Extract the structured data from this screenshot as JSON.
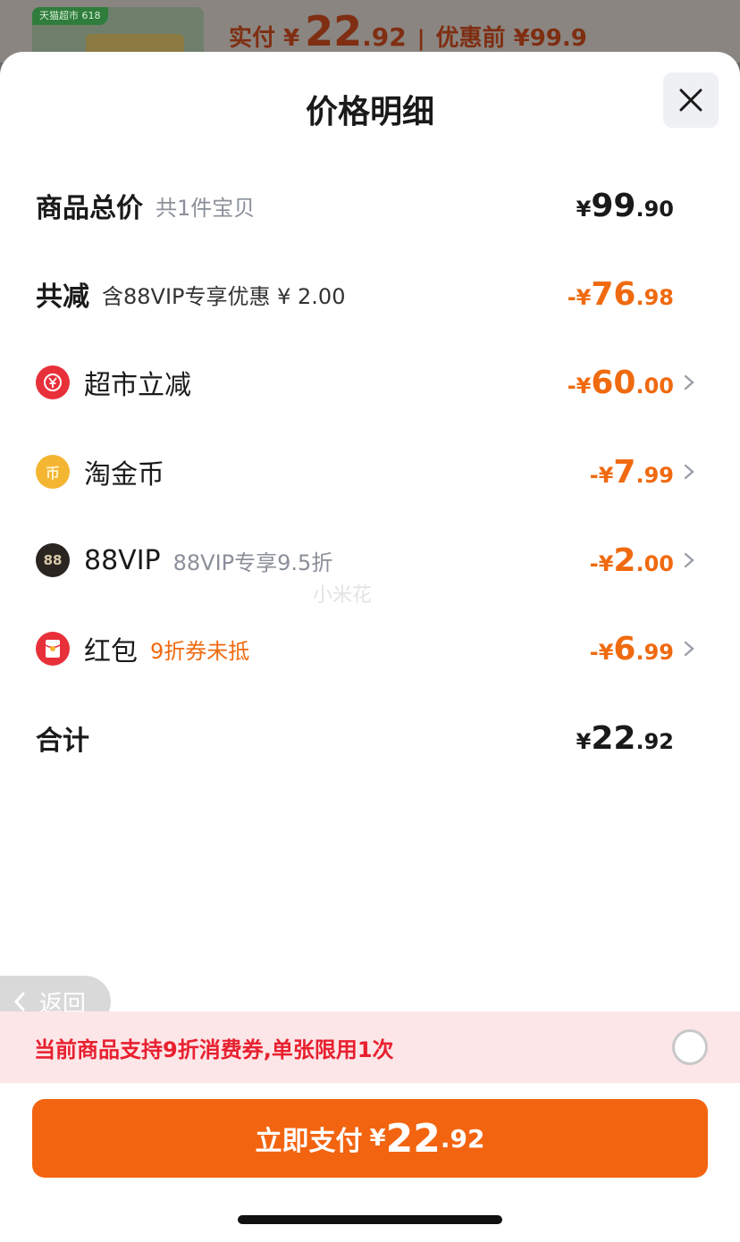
{
  "top": {
    "badge": "天猫超市 618",
    "pay_label": "实付 ¥",
    "pay_int": "22",
    "pay_dec": ".92",
    "sep": "|",
    "orig": "优惠前 ¥99.9"
  },
  "sheet": {
    "title": "价格明细"
  },
  "rows": {
    "total": {
      "name": "商品总价",
      "sub": "共1件宝贝",
      "cur": "¥",
      "int": "99",
      "dec": ".90"
    },
    "reduce": {
      "name": "共减",
      "sub": "含88VIP专享优惠 ¥ 2.00",
      "cur": "-¥",
      "int": "76",
      "dec": ".98"
    },
    "supermarket": {
      "name": "超市立减",
      "cur": "-¥",
      "int": "60",
      "dec": ".00",
      "icon": "yuan-icon"
    },
    "taojinbi": {
      "name": "淘金币",
      "cur": "-¥",
      "int": "7",
      "dec": ".99",
      "icon": "coin-icon",
      "glyph": "币"
    },
    "vip": {
      "name": "88VIP",
      "sub": "88VIP专享9.5折",
      "cur": "-¥",
      "int": "2",
      "dec": ".00",
      "icon": "vip-icon",
      "glyph": "88"
    },
    "hongbao": {
      "name": "红包",
      "sub": "9折券未抵",
      "cur": "-¥",
      "int": "6",
      "dec": ".99",
      "icon": "red-packet-icon"
    },
    "sum": {
      "name": "合计",
      "cur": "¥",
      "int": "22",
      "dec": ".92"
    }
  },
  "watermark": "小米花",
  "back": {
    "label": "返回"
  },
  "coupon": {
    "text": "当前商品支持9折消费券,单张限用1次"
  },
  "pay_button": {
    "label": "立即支付",
    "cur": "¥",
    "int": "22",
    "dec": ".92"
  },
  "colors": {
    "accent": "#f36410",
    "discount": "#f06a10",
    "coupon_text": "#e8202f",
    "coupon_bg": "#fde6e8"
  }
}
